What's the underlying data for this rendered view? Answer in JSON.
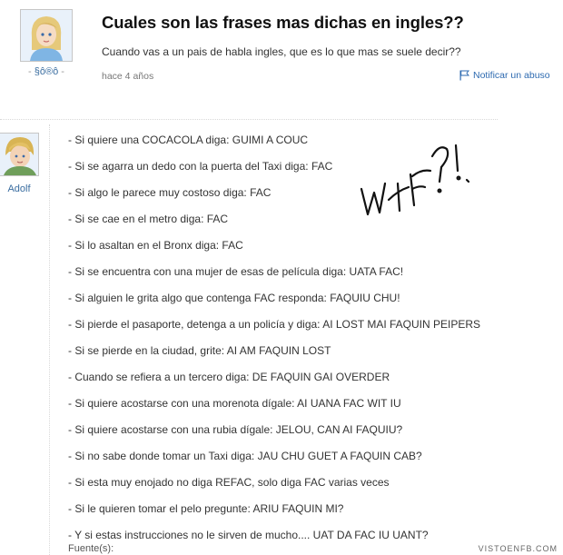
{
  "question": {
    "title": "Cuales son las frases mas dichas en ingles??",
    "description": "Cuando vas a un pais de habla ingles, que es lo que mas se suele decir??",
    "time": "hace 4 años",
    "report_label": "Notificar un abuso",
    "user": {
      "name": "§ô®ô",
      "prefix": "- ",
      "suffix": " -"
    }
  },
  "answer": {
    "user": {
      "name": "Adolf"
    },
    "lines": [
      "- Si quiere una COCACOLA diga: GUIMI A COUC",
      "- Si se agarra un dedo con la puerta del Taxi diga: FAC",
      "- Si algo le parece muy costoso diga: FAC",
      "- Si se cae en el metro diga: FAC",
      "- Si lo asaltan en el Bronx diga: FAC",
      "- Si se encuentra con una mujer de esas de película diga: UATA FAC!",
      "- Si alguien le grita algo que contenga FAC responda: FAQUIU CHU!",
      "- Si pierde el pasaporte, detenga a un policía y diga: AI LOST MAI FAQUIN PEIPERS",
      "- Si se pierde en la ciudad, grite: AI AM FAQUIN LOST",
      "- Cuando se refiera a un tercero diga: DE FAQUIN GAI OVERDER",
      "- Si quiere acostarse con una morenota dígale: AI UANA FAC WIT IU",
      "- Si quiere acostarse con una rubia dígale: JELOU, CAN AI FAQUIU?",
      "- Si no sabe donde tomar un Taxi diga: JAU CHU GUET A FAQUIN CAB?",
      "- Si esta muy enojado no diga REFAC, solo diga FAC varias veces",
      "- Si le quieren tomar el pelo pregunte: ARIU FAQUIN MI?",
      "- Y si estas instrucciones no le sirven de mucho.... UAT DA FAC IU UANT?"
    ],
    "source_label": "Fuente(s):"
  },
  "watermark": "VISTOENFB.COM",
  "colors": {
    "link": "#2d6ab0",
    "title": "#111111",
    "text": "#333333"
  }
}
